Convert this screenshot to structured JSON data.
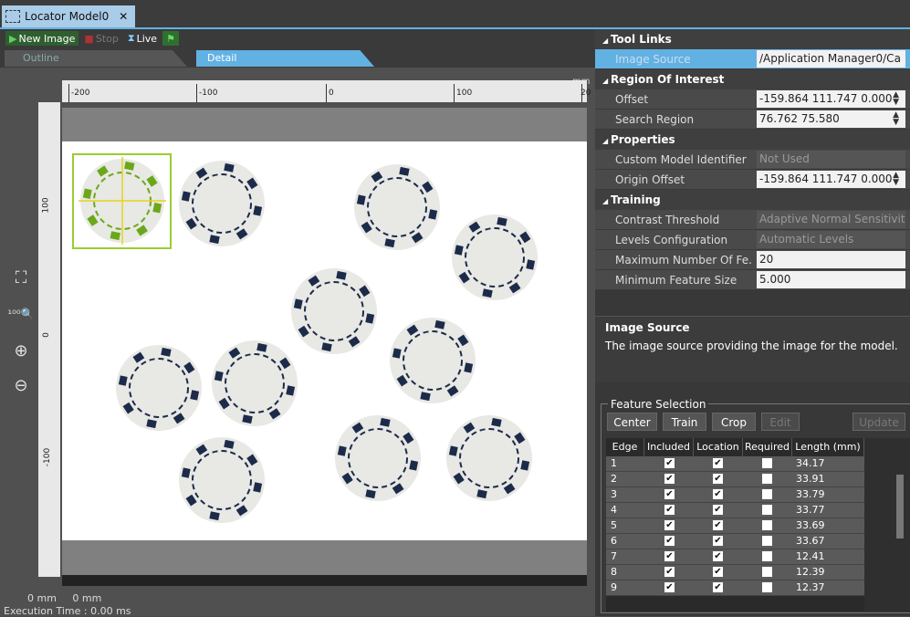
{
  "window": {
    "tab_title": "Locator Model0",
    "close_glyph": "✕"
  },
  "toolbar": {
    "new_image": "New Image",
    "stop": "Stop",
    "live": "Live"
  },
  "view_tabs": [
    "Outline",
    "Detail"
  ],
  "ruler": {
    "unit": "mm",
    "h_labels": [
      "-200",
      "-100",
      "0",
      "100",
      "20"
    ],
    "v_labels": [
      "100",
      "0",
      "-100"
    ]
  },
  "status": {
    "pos_x": "0 mm",
    "pos_y": "0 mm",
    "execution_time": "Execution Time : 0.00 ms"
  },
  "properties": {
    "sections": [
      {
        "title": "Tool Links",
        "rows": [
          {
            "name": "Image Source",
            "value": "/Application Manager0/Ca",
            "selected": true
          }
        ]
      },
      {
        "title": "Region Of Interest",
        "rows": [
          {
            "name": "Offset",
            "value": "-159.864 111.747 0.000"
          },
          {
            "name": "Search Region",
            "value": "76.762 75.580"
          }
        ]
      },
      {
        "title": "Properties",
        "rows": [
          {
            "name": "Custom Model Identifier",
            "value": "Not Used",
            "dim": true
          },
          {
            "name": "Origin Offset",
            "value": "-159.864 111.747 0.000"
          }
        ]
      },
      {
        "title": "Training",
        "rows": [
          {
            "name": "Contrast Threshold",
            "value": "Adaptive Normal Sensitivity",
            "dim": true
          },
          {
            "name": "Levels Configuration",
            "value": "Automatic Levels",
            "dim": true
          },
          {
            "name": "Maximum Number Of Fe...",
            "value": "20"
          },
          {
            "name": "Minimum Feature Size",
            "value": "5.000"
          }
        ]
      }
    ]
  },
  "help": {
    "title": "Image Source",
    "text": "The image source providing the image for the model."
  },
  "feature_selection": {
    "title": "Feature Selection",
    "buttons": [
      "Center",
      "Train",
      "Crop",
      "Edit",
      "Update"
    ],
    "columns": [
      "Edge",
      "Included",
      "Location",
      "Required",
      "Length (mm)"
    ],
    "rows": [
      {
        "edge": "1",
        "included": true,
        "location": true,
        "required": false,
        "length": "34.17"
      },
      {
        "edge": "2",
        "included": true,
        "location": true,
        "required": false,
        "length": "33.91"
      },
      {
        "edge": "3",
        "included": true,
        "location": true,
        "required": false,
        "length": "33.79"
      },
      {
        "edge": "4",
        "included": true,
        "location": true,
        "required": false,
        "length": "33.77"
      },
      {
        "edge": "5",
        "included": true,
        "location": true,
        "required": false,
        "length": "33.69"
      },
      {
        "edge": "6",
        "included": true,
        "location": true,
        "required": false,
        "length": "33.67"
      },
      {
        "edge": "7",
        "included": true,
        "location": true,
        "required": false,
        "length": "12.41"
      },
      {
        "edge": "8",
        "included": true,
        "location": true,
        "required": false,
        "length": "12.39"
      },
      {
        "edge": "9",
        "included": true,
        "location": true,
        "required": false,
        "length": "12.37"
      }
    ]
  },
  "icons": [
    "dashed-square-icon",
    "close-icon",
    "play-icon",
    "stop-icon",
    "live-icon",
    "flag-icon",
    "fit-view-icon",
    "zoom-100-icon",
    "zoom-in-icon",
    "zoom-out-icon",
    "collapse-triangle-icon",
    "spinner-icon",
    "check-icon"
  ],
  "colors": {
    "accent": "#62b1e3",
    "roi": "#9acd32",
    "chip_mark": "#1d2b4a",
    "chip_face": "#e8e8e4"
  }
}
